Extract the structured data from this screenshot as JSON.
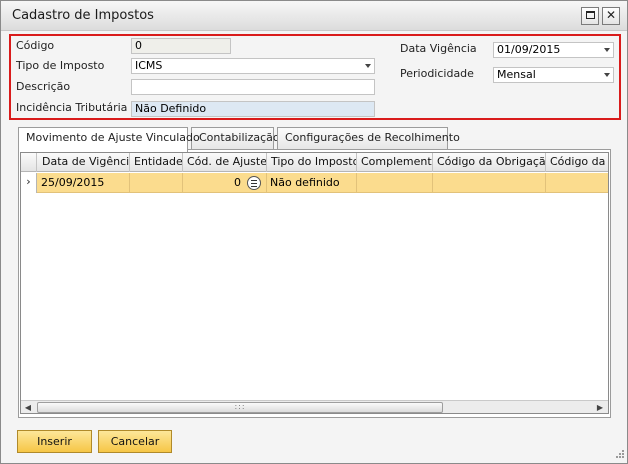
{
  "window": {
    "title": "Cadastro de Impostos"
  },
  "header": {
    "codigo_label": "Código",
    "codigo_value": "0",
    "tipo_imposto_label": "Tipo de Imposto",
    "tipo_imposto_value": "ICMS",
    "descricao_label": "Descrição",
    "descricao_value": "",
    "incidencia_label": "Incidência Tributária",
    "incidencia_value": "Não Definido",
    "data_vigencia_label": "Data Vigência",
    "data_vigencia_value": "01/09/2015",
    "periodicidade_label": "Periodicidade",
    "periodicidade_value": "Mensal"
  },
  "tabs": [
    {
      "label": "Movimento de Ajuste Vinculado",
      "active": true
    },
    {
      "label": "Contabilização",
      "active": false
    },
    {
      "label": "Configurações de Recolhimento",
      "active": false
    }
  ],
  "grid": {
    "columns": [
      "Data de Vigência",
      "Entidade",
      "Cód. de Ajuste",
      "Tipo do Imposto",
      "Complemento",
      "Código da Obrigação",
      "Código da R"
    ],
    "rows": [
      {
        "data_vigencia": "25/09/2015",
        "entidade": "",
        "cod_ajuste": "0",
        "tipo_imposto": "Não definido",
        "complemento": "",
        "codigo_obrigacao": "",
        "codigo_r": ""
      }
    ],
    "row_indicator": "›",
    "scroll_left_icon": "◀",
    "scroll_right_icon": "▶",
    "scroll_thumb_grip": ":::"
  },
  "buttons": {
    "inserir": "Inserir",
    "cancelar": "Cancelar"
  },
  "colors": {
    "accent_border": "#d91b1b",
    "selected_row": "#fbdc8e",
    "button_fill": "#f6c646"
  }
}
